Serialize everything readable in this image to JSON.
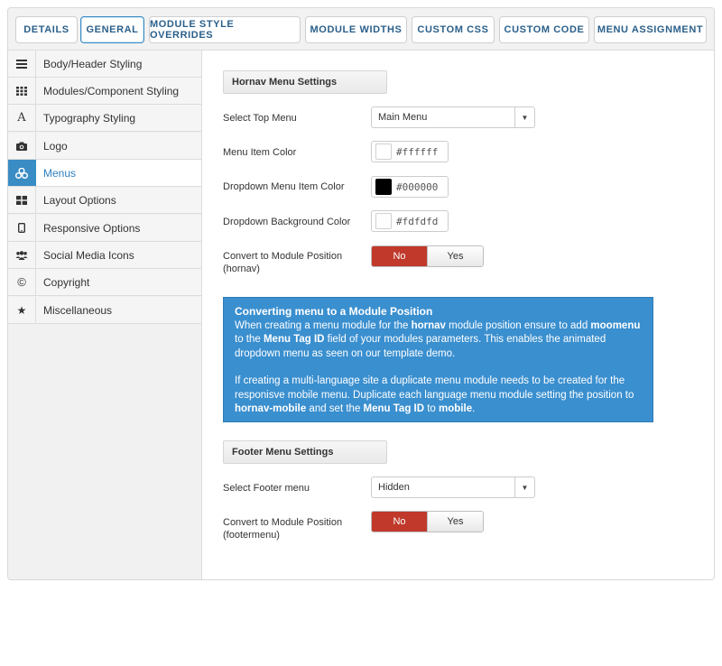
{
  "tabs": [
    {
      "id": "details",
      "label": "Details"
    },
    {
      "id": "general",
      "label": "General"
    },
    {
      "id": "module-style-overrides",
      "label": "Module Style Overrides"
    },
    {
      "id": "module-widths",
      "label": "Module Widths"
    },
    {
      "id": "custom-css",
      "label": "Custom CSS"
    },
    {
      "id": "custom-code",
      "label": "Custom Code"
    },
    {
      "id": "menu-assignment",
      "label": "Menu Assignment"
    }
  ],
  "active_tab": "General",
  "sidebar": {
    "active": "Menus",
    "items": [
      {
        "label": "Body/Header Styling",
        "icon": "bars-icon"
      },
      {
        "label": "Modules/Component Styling",
        "icon": "grid-icon"
      },
      {
        "label": "Typography Styling",
        "icon": "font-icon"
      },
      {
        "label": "Logo",
        "icon": "camera-icon"
      },
      {
        "label": "Menus",
        "icon": "cubes-icon"
      },
      {
        "label": "Layout Options",
        "icon": "layout-icon"
      },
      {
        "label": "Responsive Options",
        "icon": "tablet-icon"
      },
      {
        "label": "Social Media Icons",
        "icon": "users-icon"
      },
      {
        "label": "Copyright",
        "icon": "copyright-icon"
      },
      {
        "label": "Miscellaneous",
        "icon": "star-icon"
      }
    ]
  },
  "hornav": {
    "heading": "Hornav Menu Settings",
    "select_top_menu_label": "Select Top Menu",
    "select_top_menu_value": "Main Menu",
    "menu_item_color_label": "Menu Item Color",
    "menu_item_color": "#ffffff",
    "dropdown_item_color_label": "Dropdown Menu Item Color",
    "dropdown_item_color": "#000000",
    "dropdown_bg_label": "Dropdown Background Color",
    "dropdown_bg_color": "#fdfdfd",
    "convert_label": "Convert to Module Position",
    "convert_sub": "(hornav)",
    "no": "No",
    "yes": "Yes",
    "selected": "No"
  },
  "info": {
    "title": "Converting menu to a Module Position",
    "p1_a": "When creating a menu module for the ",
    "p1_b": "hornav",
    "p1_c": " module position ensure to add ",
    "p1_d": "moomenu",
    "p1_e": " to the ",
    "p1_f": "Menu Tag ID",
    "p1_g": " field of your modules parameters. This enables the animated dropdown menu as seen on our template demo.",
    "p2_a": "If creating a multi-language site a duplicate menu module needs to be created for the responisve mobile menu. Duplicate each language menu module setting the position to ",
    "p2_b": "hornav-mobile",
    "p2_c": " and set the ",
    "p2_d": "Menu Tag ID",
    "p2_e": " to ",
    "p2_f": "mobile",
    "p2_g": "."
  },
  "footer": {
    "heading": "Footer Menu Settings",
    "select_label": "Select Footer menu",
    "select_value": "Hidden",
    "convert_label": "Convert to Module Position",
    "convert_sub": "(footermenu)",
    "no": "No",
    "yes": "Yes",
    "selected": "No"
  },
  "colors": {
    "accent": "#3a8cc4",
    "toggle_active": "#c0392b",
    "info_bg": "#3a8fcf"
  }
}
